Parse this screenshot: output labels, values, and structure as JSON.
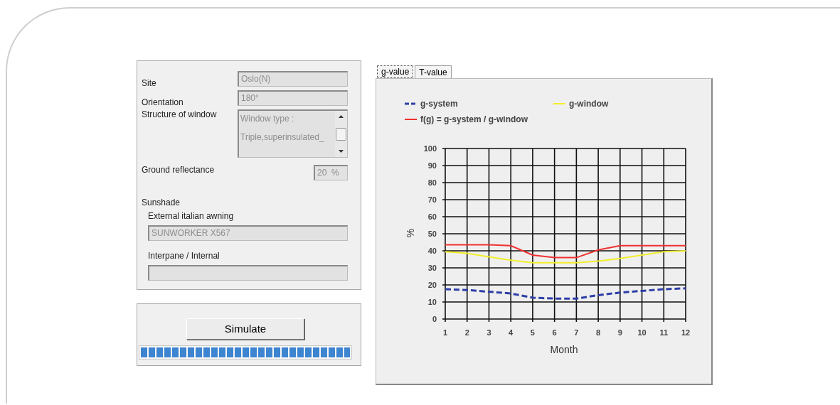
{
  "settings": {
    "fields": [
      {
        "kind": "text",
        "label": "Site",
        "value": "Oslo(N)",
        "disabled": true
      },
      {
        "kind": "text",
        "label": "Orientation",
        "value": "180°",
        "disabled": true
      },
      {
        "kind": "list",
        "label": "Structure of window",
        "lines": [
          "Window type :",
          "Triple,superinsulated_"
        ],
        "disabled": true
      },
      {
        "kind": "short",
        "label": "Ground reflectance",
        "value": "20  %",
        "disabled": true
      }
    ],
    "sunshade": {
      "title": "Sunshade",
      "fields": [
        {
          "label": "External italian awning",
          "value": "SUNWORKER X567",
          "disabled": true
        },
        {
          "label": "Interpane / Internal",
          "disabled": true
        }
      ]
    }
  },
  "simulate": {
    "button": "Simulate",
    "progress": {
      "level": 1
    }
  },
  "tabs": [
    {
      "label": "g-value",
      "selected": true
    },
    {
      "label": "T-value",
      "selected": false
    }
  ],
  "chart_data": {
    "type": "line",
    "xlabel": "Month",
    "ylabel": "%",
    "grid": true,
    "legend": true,
    "x": [
      1,
      2,
      3,
      4,
      5,
      6,
      7,
      8,
      9,
      10,
      11,
      12
    ],
    "xlim": [
      1,
      12
    ],
    "ylim": [
      0,
      100
    ],
    "yticks": [
      0,
      10,
      20,
      30,
      40,
      50,
      60,
      70,
      80,
      90,
      100
    ],
    "xticks": [
      1,
      2,
      3,
      4,
      5,
      6,
      7,
      8,
      9,
      10,
      11,
      12
    ],
    "series": [
      {
        "name": "g-system",
        "color": "#2e3fa8",
        "line_style": "dashed",
        "values": [
          17.5,
          17,
          16,
          15,
          12.5,
          12,
          12,
          14,
          15.5,
          16.5,
          17.5,
          18
        ]
      },
      {
        "name": "g-window",
        "color": "#f2ee2a",
        "line_style": "solid",
        "values": [
          39.5,
          38.5,
          36.5,
          34.5,
          33,
          33,
          33,
          34,
          35.5,
          37.5,
          39.5,
          40
        ]
      },
      {
        "name": "f(g) = g-system / g-window",
        "color": "#f03030",
        "line_style": "solid",
        "values": [
          43.5,
          43.5,
          43.5,
          43,
          37.5,
          36,
          36,
          40.5,
          43,
          43,
          43,
          43
        ]
      }
    ]
  }
}
